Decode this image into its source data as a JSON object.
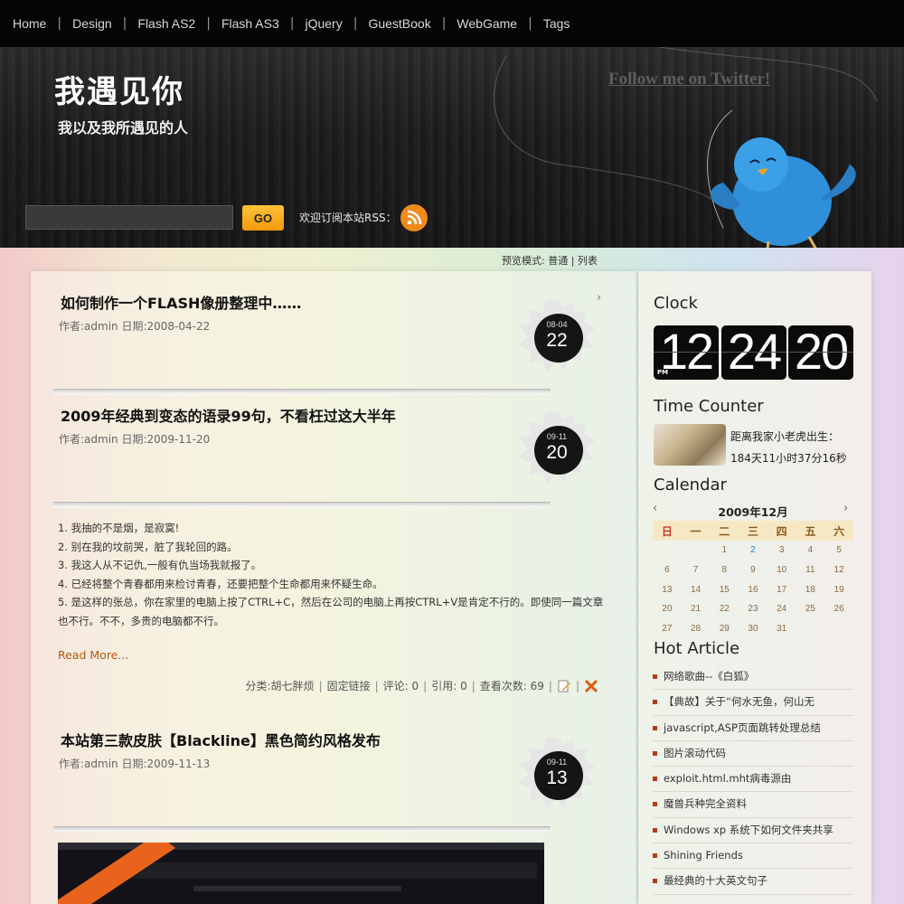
{
  "nav": {
    "items": [
      "Home",
      "Design",
      "Flash AS2",
      "Flash AS3",
      "jQuery",
      "GuestBook",
      "WebGame",
      "Tags"
    ]
  },
  "header": {
    "title": "我遇见你",
    "subtitle": "我以及我所遇见的人",
    "twitter_link": "Follow me on Twitter!",
    "search_placeholder": "",
    "go_label": "GO",
    "rss_label": "欢迎订阅本站RSS："
  },
  "view_mode": {
    "label": "预览模式:",
    "normal": "普通",
    "list": "列表"
  },
  "posts": [
    {
      "title": "如何制作一个FLASH像册整理中……",
      "meta": "作者:admin  日期:2008-04-22",
      "month": "08-04",
      "day": "22"
    },
    {
      "title": "2009年经典到变态的语录99句，不看枉过这大半年",
      "meta": "作者:admin  日期:2009-11-20",
      "month": "09-11",
      "day": "20",
      "body": [
        "1. 我抽的不是烟，是寂寞!",
        "2. 别在我的坟前哭，脏了我轮回的路。",
        "3. 我这人从不记仇,一般有仇当场我就报了。",
        "4. 已经将整个青春都用来检讨青春，还要把整个生命都用来怀疑生命。",
        "5. 是这样的张总，你在家里的电脑上按了CTRL+C，然后在公司的电脑上再按CTRL+V是肯定不行的。即使同一篇文章也不行。不不，多贵的电脑都不行。"
      ],
      "read_more": "Read More...",
      "footer": {
        "category": "分类:胡七胖烦",
        "permalink": "固定链接",
        "comments": "评论: 0",
        "trackbacks": "引用: 0",
        "views": "查看次数: 69"
      }
    },
    {
      "title": "本站第三款皮肤【Blackline】黑色简约风格发布",
      "meta": "作者:admin  日期:2009-11-13",
      "month": "09-11",
      "day": "13"
    }
  ],
  "sidebar": {
    "clock": {
      "title": "Clock",
      "hour": "12",
      "minute": "24",
      "second": "20",
      "ampm": "PM"
    },
    "time_counter": {
      "title": "Time Counter",
      "label": "距离我家小老虎出生：",
      "value": "184天11小时37分16秒"
    },
    "calendar": {
      "title": "Calendar",
      "month": "2009年12月",
      "weekdays": [
        "日",
        "一",
        "二",
        "三",
        "四",
        "五",
        "六"
      ],
      "weeks": [
        [
          "",
          "",
          "1",
          "2",
          "3",
          "4",
          "5"
        ],
        [
          "6",
          "7",
          "8",
          "9",
          "10",
          "11",
          "12"
        ],
        [
          "13",
          "14",
          "15",
          "16",
          "17",
          "18",
          "19"
        ],
        [
          "20",
          "21",
          "22",
          "23",
          "24",
          "25",
          "26"
        ],
        [
          "27",
          "28",
          "29",
          "30",
          "31",
          "",
          ""
        ]
      ],
      "today": "2"
    },
    "hot_article": {
      "title": "Hot Article",
      "items": [
        "网络歌曲--《白狐》",
        "【典故】关于“何水无鱼，何山无",
        "javascript,ASP页面跳转处理总结",
        "图片滚动代码",
        "exploit.html.mht病毒源由",
        "魔兽兵种完全资料",
        "Windows xp 系统下如何文件夹共享",
        "Shining Friends",
        "最经典的十大英文句子"
      ]
    }
  },
  "colors": {
    "accent": "#f39a0b",
    "link": "#b25a10",
    "calendar_today": "#1e7fd0"
  }
}
